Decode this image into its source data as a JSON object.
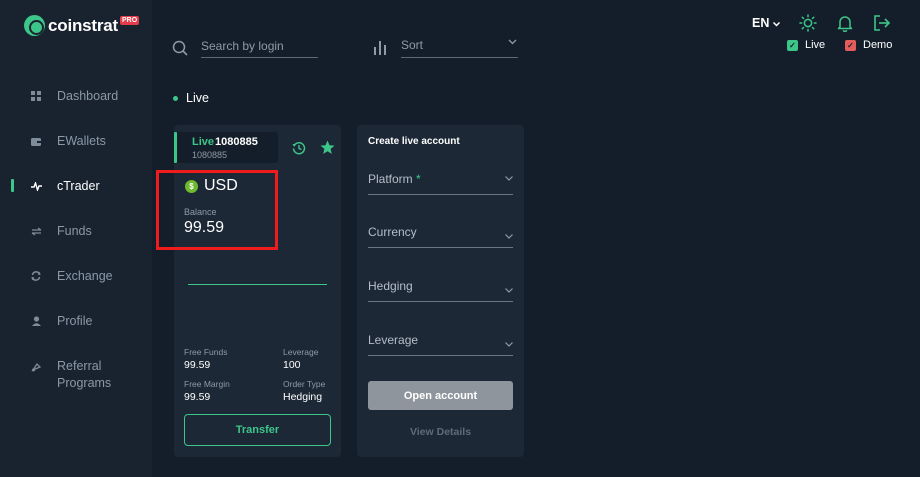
{
  "brand": {
    "name": "coinstrat",
    "badge": "PRO"
  },
  "sidebar": {
    "items": [
      {
        "label": "Dashboard",
        "icon": "grid-icon",
        "active": false
      },
      {
        "label": "EWallets",
        "icon": "wallet-icon",
        "active": false
      },
      {
        "label": "cTrader",
        "icon": "pulse-icon",
        "active": true
      },
      {
        "label": "Funds",
        "icon": "swap-icon",
        "active": false
      },
      {
        "label": "Exchange",
        "icon": "refresh-icon",
        "active": false
      },
      {
        "label": "Profile",
        "icon": "user-icon",
        "active": false
      },
      {
        "label": "Referral",
        "label2": "Programs",
        "icon": "referral-icon",
        "active": false
      }
    ]
  },
  "toolbar": {
    "search_placeholder": "Search by login",
    "sort_placeholder": "Sort",
    "language": "EN",
    "live_label": "Live",
    "demo_label": "Demo",
    "live_checked": true,
    "demo_checked": true
  },
  "section": {
    "title": "Live"
  },
  "account": {
    "type": "Live",
    "number": "1080885",
    "login": "1080885",
    "currency": "USD",
    "currency_symbol": "$",
    "balance_label": "Balance",
    "balance": "99.59",
    "stats": {
      "free_funds_label": "Free Funds",
      "free_funds": "99.59",
      "leverage_label": "Leverage",
      "leverage": "100",
      "free_margin_label": "Free Margin",
      "free_margin": "99.59",
      "order_type_label": "Order Type",
      "order_type": "Hedging"
    },
    "transfer_label": "Transfer"
  },
  "create_form": {
    "title": "Create live account",
    "fields": [
      {
        "label": "Platform",
        "required": "*"
      },
      {
        "label": "Currency"
      },
      {
        "label": "Hedging"
      },
      {
        "label": "Leverage"
      }
    ],
    "open_label": "Open account",
    "view_details_label": "View Details"
  },
  "colors": {
    "accent": "#3dc68a",
    "demo": "#e55c5c",
    "highlight": "#ee1c1c"
  }
}
